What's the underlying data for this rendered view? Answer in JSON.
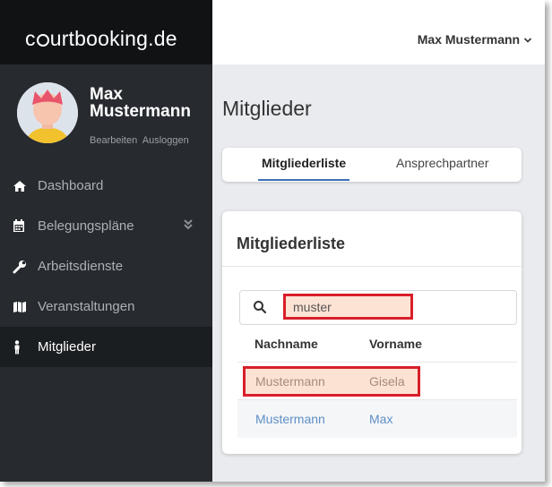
{
  "brand": {
    "logo_text_before": "c",
    "logo_text_after": "urtbooking.de"
  },
  "user": {
    "display_name": "Max Mustermann",
    "name_line1": "Max",
    "name_line2": "Mustermann",
    "edit_link": "Bearbeiten",
    "logout_link": "Ausloggen"
  },
  "sidebar": {
    "items": [
      {
        "label": "Dashboard",
        "icon": "home-icon"
      },
      {
        "label": "Belegungspläne",
        "icon": "calendar-icon"
      },
      {
        "label": "Arbeitsdienste",
        "icon": "wrench-icon"
      },
      {
        "label": "Veranstaltungen",
        "icon": "map-icon"
      },
      {
        "label": "Mitglieder",
        "icon": "person-icon"
      }
    ],
    "active": "Mitglieder"
  },
  "page": {
    "title": "Mitglieder"
  },
  "tabs": [
    {
      "label": "Mitgliederliste",
      "active": true
    },
    {
      "label": "Ansprechpartner",
      "active": false
    }
  ],
  "card": {
    "title": "Mitgliederliste",
    "search": {
      "value": "muster",
      "placeholder": ""
    },
    "columns": [
      "Nachname",
      "Vorname"
    ],
    "rows": [
      {
        "nachname": "Mustermann",
        "vorname": "Gisela"
      },
      {
        "nachname": "Mustermann",
        "vorname": "Max"
      }
    ]
  },
  "colors": {
    "sidebar": "#272b2f",
    "topbar_logo": "#111214",
    "link": "#5d8fc5",
    "highlight_border": "#d81f2a",
    "accent": "#3b6fb6"
  }
}
